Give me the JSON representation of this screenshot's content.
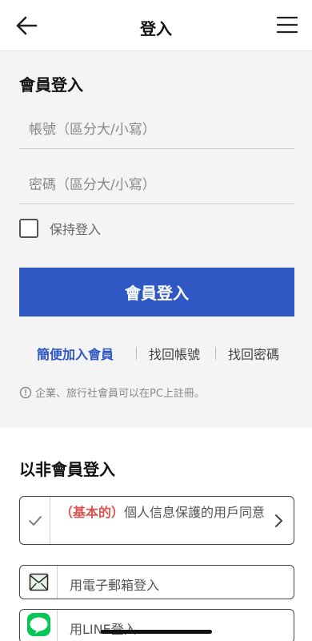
{
  "header": {
    "title": "登入"
  },
  "member_login": {
    "section_title": "會員登入",
    "account_placeholder": "帳號（區分大/小寫）",
    "password_placeholder": "密碼（區分大/小寫）",
    "keep_logged_in": "保持登入",
    "keep_logged_in_checked": false,
    "login_button": "會員登入",
    "links": {
      "join": "簡便加入會員",
      "find_account": "找回帳號",
      "find_password": "找回密碼"
    },
    "notice": "企業、旅行社會員可以在PC上註冊。"
  },
  "non_member_login": {
    "section_title": "以非會員登入",
    "consent": {
      "tag": "（基本的）",
      "text": "個人信息保護的用戶同意"
    },
    "methods": {
      "email": "用電子郵箱登入",
      "line": "用LINE登入"
    }
  },
  "colors": {
    "accent": "#2f58c4",
    "consent_tag": "#d9534f",
    "line_green": "#06c755"
  }
}
